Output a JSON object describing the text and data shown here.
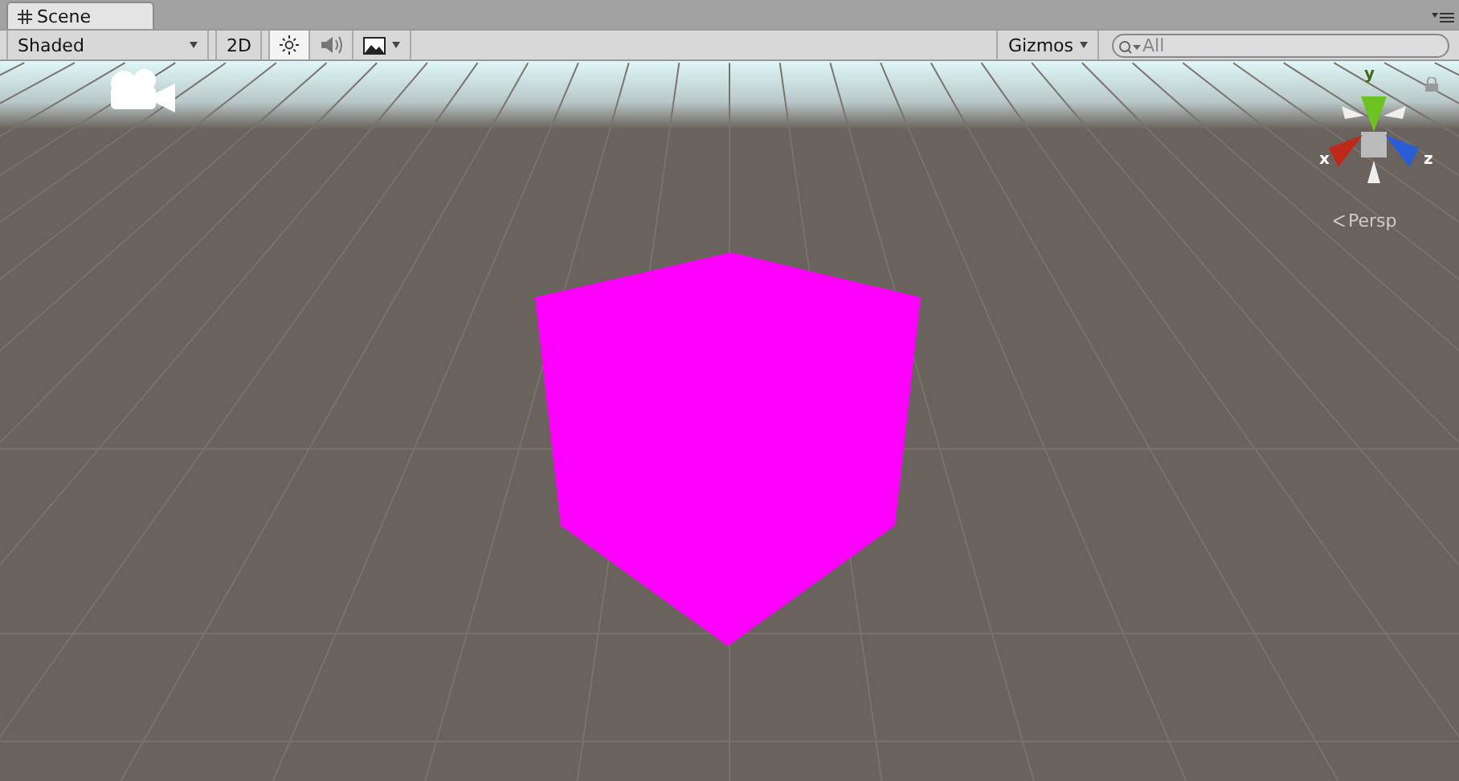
{
  "tabs": [
    {
      "label": "Scene",
      "selected": true
    }
  ],
  "toolbar": {
    "shading": "Shaded",
    "mode_2d": {
      "label": "2D",
      "selected": false
    },
    "lighting": {
      "selected": true
    },
    "audio": {
      "selected": false
    },
    "effects": {
      "selected": false
    },
    "gizmos": "Gizmos",
    "search": {
      "placeholder": "All"
    }
  },
  "viewport": {
    "axes": [
      {
        "label": "y",
        "kind": "up"
      },
      {
        "label": "x",
        "kind": "left"
      },
      {
        "label": "z",
        "kind": "right"
      }
    ],
    "projection": "Persp"
  }
}
